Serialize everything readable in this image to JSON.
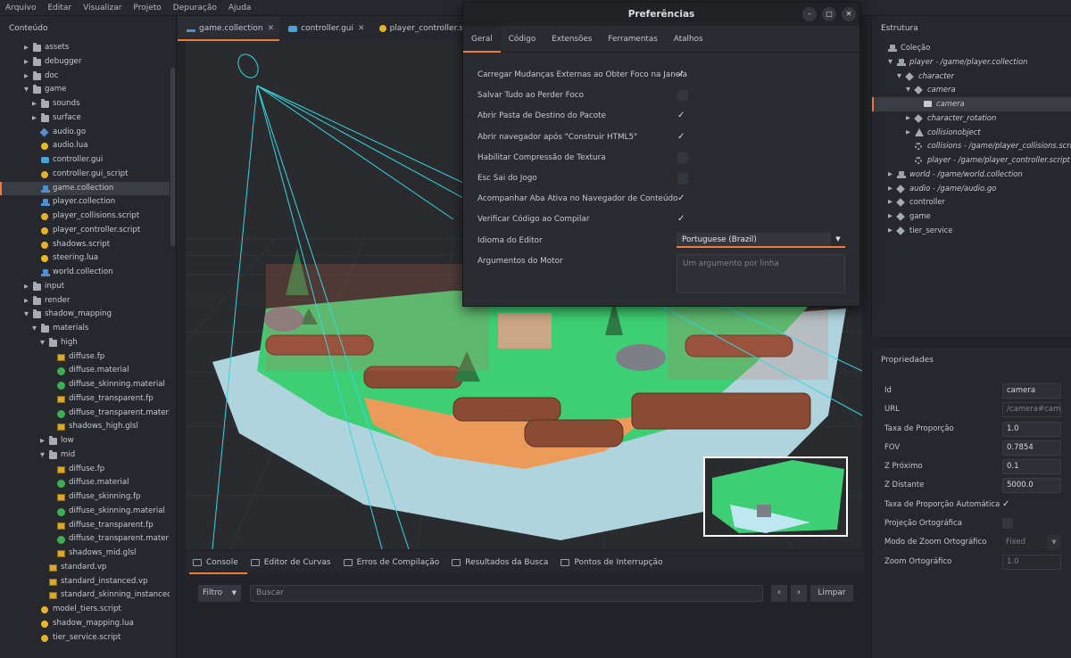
{
  "menu": [
    "Arquivo",
    "Editar",
    "Visualizar",
    "Projeto",
    "Depuração",
    "Ajuda"
  ],
  "left_panel": {
    "title": "Conteúdo",
    "items": [
      {
        "label": "assets",
        "type": "folder",
        "depth": 1,
        "arrow": "right"
      },
      {
        "label": "debugger",
        "type": "folder",
        "depth": 1,
        "arrow": "right"
      },
      {
        "label": "doc",
        "type": "folder",
        "depth": 1,
        "arrow": "right"
      },
      {
        "label": "game",
        "type": "folder",
        "depth": 1,
        "arrow": "down"
      },
      {
        "label": "sounds",
        "type": "folder",
        "depth": 2,
        "arrow": "right"
      },
      {
        "label": "surface",
        "type": "folder",
        "depth": 2,
        "arrow": "right"
      },
      {
        "label": "audio.go",
        "type": "go",
        "depth": 2
      },
      {
        "label": "audio.lua",
        "type": "lua",
        "depth": 2
      },
      {
        "label": "controller.gui",
        "type": "gui",
        "depth": 2
      },
      {
        "label": "controller.gui_script",
        "type": "script",
        "depth": 2
      },
      {
        "label": "game.collection",
        "type": "collection",
        "depth": 2,
        "selected": true
      },
      {
        "label": "player.collection",
        "type": "collection",
        "depth": 2
      },
      {
        "label": "player_collisions.script",
        "type": "script",
        "depth": 2
      },
      {
        "label": "player_controller.script",
        "type": "script",
        "depth": 2
      },
      {
        "label": "shadows.script",
        "type": "script",
        "depth": 2
      },
      {
        "label": "steering.lua",
        "type": "lua",
        "depth": 2
      },
      {
        "label": "world.collection",
        "type": "collection",
        "depth": 2
      },
      {
        "label": "input",
        "type": "folder",
        "depth": 1,
        "arrow": "right"
      },
      {
        "label": "render",
        "type": "folder",
        "depth": 1,
        "arrow": "right"
      },
      {
        "label": "shadow_mapping",
        "type": "folder",
        "depth": 1,
        "arrow": "down"
      },
      {
        "label": "materials",
        "type": "folder",
        "depth": 2,
        "arrow": "down"
      },
      {
        "label": "high",
        "type": "folder",
        "depth": 3,
        "arrow": "down"
      },
      {
        "label": "diffuse.fp",
        "type": "shader",
        "depth": 4
      },
      {
        "label": "diffuse.material",
        "type": "material",
        "depth": 4
      },
      {
        "label": "diffuse_skinning.material",
        "type": "material",
        "depth": 4
      },
      {
        "label": "diffuse_transparent.fp",
        "type": "shader",
        "depth": 4
      },
      {
        "label": "diffuse_transparent.material",
        "type": "material",
        "depth": 4
      },
      {
        "label": "shadows_high.glsl",
        "type": "shader",
        "depth": 4
      },
      {
        "label": "low",
        "type": "folder",
        "depth": 3,
        "arrow": "right"
      },
      {
        "label": "mid",
        "type": "folder",
        "depth": 3,
        "arrow": "down"
      },
      {
        "label": "diffuse.fp",
        "type": "shader",
        "depth": 4
      },
      {
        "label": "diffuse.material",
        "type": "material",
        "depth": 4
      },
      {
        "label": "diffuse_skinning.fp",
        "type": "shader",
        "depth": 4
      },
      {
        "label": "diffuse_skinning.material",
        "type": "material",
        "depth": 4
      },
      {
        "label": "diffuse_transparent.fp",
        "type": "shader",
        "depth": 4
      },
      {
        "label": "diffuse_transparent.material",
        "type": "material",
        "depth": 4
      },
      {
        "label": "shadows_mid.glsl",
        "type": "shader",
        "depth": 4
      },
      {
        "label": "standard.vp",
        "type": "shader",
        "depth": 3
      },
      {
        "label": "standard_instanced.vp",
        "type": "shader",
        "depth": 3
      },
      {
        "label": "standard_skinning_instanced.vp",
        "type": "shader",
        "depth": 3
      },
      {
        "label": "model_tiers.script",
        "type": "script",
        "depth": 2
      },
      {
        "label": "shadow_mapping.lua",
        "type": "lua",
        "depth": 2
      },
      {
        "label": "tier_service.script",
        "type": "script",
        "depth": 2
      }
    ]
  },
  "editor_tabs": [
    {
      "label": "game.collection",
      "icon": "collection",
      "active": true
    },
    {
      "label": "controller.gui",
      "icon": "gui"
    },
    {
      "label": "player_controller.script",
      "icon": "script"
    }
  ],
  "bottom_tabs": [
    {
      "label": "Console",
      "active": true
    },
    {
      "label": "Editor de Curvas"
    },
    {
      "label": "Erros de Compilação"
    },
    {
      "label": "Resultados da Busca"
    },
    {
      "label": "Pontos de Interrupção"
    }
  ],
  "console": {
    "filter_label": "Filtro",
    "search_placeholder": "Buscar",
    "prev": "‹",
    "next": "›",
    "clear_label": "Limpar"
  },
  "outline": {
    "title": "Estrutura",
    "items": [
      {
        "label": "Coleção",
        "icon": "col",
        "depth": 0,
        "italic": false
      },
      {
        "label": "player - /game/player.collection",
        "icon": "col",
        "depth": 1,
        "arrow": "down",
        "italic": true
      },
      {
        "label": "character",
        "icon": "cube",
        "depth": 2,
        "arrow": "down",
        "italic": true
      },
      {
        "label": "camera",
        "icon": "cube",
        "depth": 3,
        "arrow": "down",
        "italic": true
      },
      {
        "label": "camera",
        "icon": "cam",
        "depth": 4,
        "italic": true,
        "selected": true
      },
      {
        "label": "character_rotation",
        "icon": "cube",
        "depth": 3,
        "arrow": "right",
        "italic": true
      },
      {
        "label": "collisionobject",
        "icon": "tri",
        "depth": 3,
        "arrow": "right",
        "italic": true
      },
      {
        "label": "collisions - /game/player_collisions.script",
        "icon": "gear",
        "depth": 3,
        "italic": true
      },
      {
        "label": "player - /game/player_controller.script",
        "icon": "gear",
        "depth": 3,
        "italic": true
      },
      {
        "label": "world - /game/world.collection",
        "icon": "col",
        "depth": 1,
        "arrow": "right",
        "italic": true
      },
      {
        "label": "audio - /game/audio.go",
        "icon": "cube",
        "depth": 1,
        "arrow": "right",
        "italic": true
      },
      {
        "label": "controller",
        "icon": "cube",
        "depth": 1,
        "arrow": "right",
        "italic": false
      },
      {
        "label": "game",
        "icon": "cube",
        "depth": 1,
        "arrow": "right",
        "italic": false
      },
      {
        "label": "tier_service",
        "icon": "cube",
        "depth": 1,
        "arrow": "right",
        "italic": false
      }
    ]
  },
  "properties": {
    "title": "Propriedades",
    "rows": [
      {
        "label": "Id",
        "kind": "text",
        "value": "camera"
      },
      {
        "label": "URL",
        "kind": "dim",
        "value": "/camera#came"
      },
      {
        "label": "Taxa de Proporção",
        "kind": "text",
        "value": "1.0"
      },
      {
        "label": "FOV",
        "kind": "text",
        "value": "0.7854"
      },
      {
        "label": "Z Próximo",
        "kind": "text",
        "value": "0.1"
      },
      {
        "label": "Z Distante",
        "kind": "text",
        "value": "5000.0"
      },
      {
        "label": "Taxa de Proporção Automática",
        "kind": "check",
        "value": "✓"
      },
      {
        "label": "Projeção Ortográfica",
        "kind": "box",
        "value": ""
      },
      {
        "label": "Modo de Zoom Ortográfico",
        "kind": "select",
        "value": "Fixed"
      },
      {
        "label": "Zoom Ortográfico",
        "kind": "dim",
        "value": "1.0"
      }
    ]
  },
  "dialog": {
    "title": "Preferências",
    "minimize": "–",
    "maximize": "□",
    "close": "✕",
    "tabs": [
      {
        "label": "Geral",
        "active": true
      },
      {
        "label": "Código"
      },
      {
        "label": "Extensões"
      },
      {
        "label": "Ferramentas"
      },
      {
        "label": "Atalhos"
      }
    ],
    "options": [
      {
        "label": "Carregar Mudanças Externas ao Obter Foco na Janela",
        "checked": true
      },
      {
        "label": "Salvar Tudo ao Perder Foco",
        "checked": false
      },
      {
        "label": "Abrir Pasta de Destino do Pacote",
        "checked": true
      },
      {
        "label": "Abrir navegador após \"Construir HTML5\"",
        "checked": true
      },
      {
        "label": "Habilitar Compressão de Textura",
        "checked": false
      },
      {
        "label": "Esc Sai do Jogo",
        "checked": false
      },
      {
        "label": "Acompanhar Aba Ativa no Navegador de Conteúdo",
        "checked": true
      },
      {
        "label": "Verificar Código ao Compilar",
        "checked": true
      }
    ],
    "language_label": "Idioma do Editor",
    "language_value": "Portuguese (Brazil)",
    "engine_args_label": "Argumentos do Motor",
    "engine_args_placeholder": "Um argumento por linha",
    "check_mark": "✓"
  }
}
